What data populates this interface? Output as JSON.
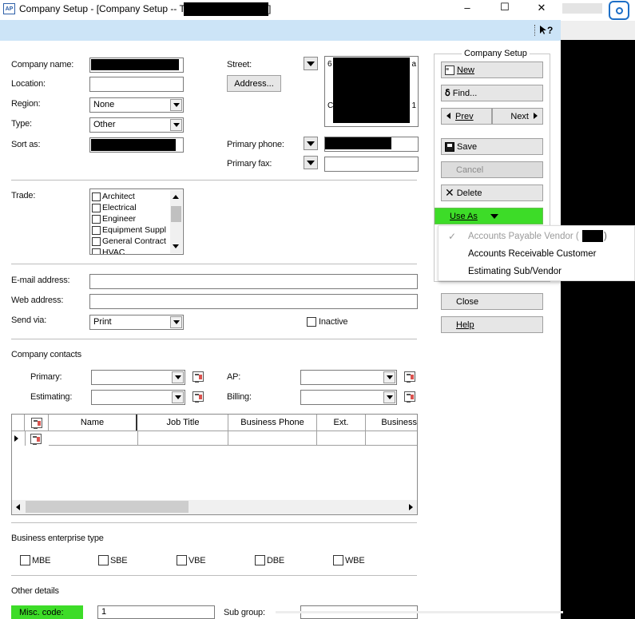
{
  "window": {
    "title": "Company Setup - [Company Setup -- T",
    "title_end": "]",
    "app_icon": "AP",
    "minimize": "–",
    "maximize": "☐",
    "close": "✕"
  },
  "toolbar": {
    "help_icon": "?"
  },
  "form": {
    "company_name_label": "Company name:",
    "location_label": "Location:",
    "region_label": "Region:",
    "region_value": "None",
    "type_label": "Type:",
    "type_value": "Other",
    "sort_as_label": "Sort as:",
    "street_label": "Street:",
    "address_button": "Address...",
    "street_line1_start": "6",
    "street_line1_end": "a",
    "street_line2_start": "C",
    "street_line2_end": "1",
    "primary_phone_label": "Primary phone:",
    "primary_fax_label": "Primary fax:",
    "trade_label": "Trade:",
    "trades": [
      "Architect",
      "Electrical",
      "Engineer",
      "Equipment Suppl",
      "General Contract",
      "HVAC"
    ],
    "email_label": "E-mail address:",
    "web_label": "Web address:",
    "send_via_label": "Send via:",
    "send_via_value": "Print",
    "inactive_label": "Inactive",
    "contacts_label": "Company contacts",
    "primary_label": "Primary:",
    "estimating_label": "Estimating:",
    "ap_label": "AP:",
    "billing_label": "Billing:",
    "grid_columns": [
      "Name",
      "Job Title",
      "Business Phone",
      "Ext.",
      "Business"
    ],
    "bet_label": "Business enterprise type",
    "bet_options": [
      "MBE",
      "SBE",
      "VBE",
      "DBE",
      "WBE"
    ],
    "other_details_label": "Other details",
    "misc_code_label": "Misc. code:",
    "misc_code_value": "1",
    "sub_group_label": "Sub group:"
  },
  "side": {
    "group_label": "Company Setup",
    "new": "New",
    "find": "Find...",
    "prev": "Prev",
    "next": "Next",
    "save": "Save",
    "cancel": "Cancel",
    "delete": "Delete",
    "use_as": "Use As",
    "close": "Close",
    "help": "Help"
  },
  "use_as_menu": {
    "items": [
      "Accounts Payable Vendor (",
      "Accounts Receivable Customer",
      "Estimating Sub/Vendor"
    ],
    "item0_end": ")"
  },
  "colors": {
    "accent_strip": "#cce4f7",
    "highlight_green": "#3ddc28"
  }
}
